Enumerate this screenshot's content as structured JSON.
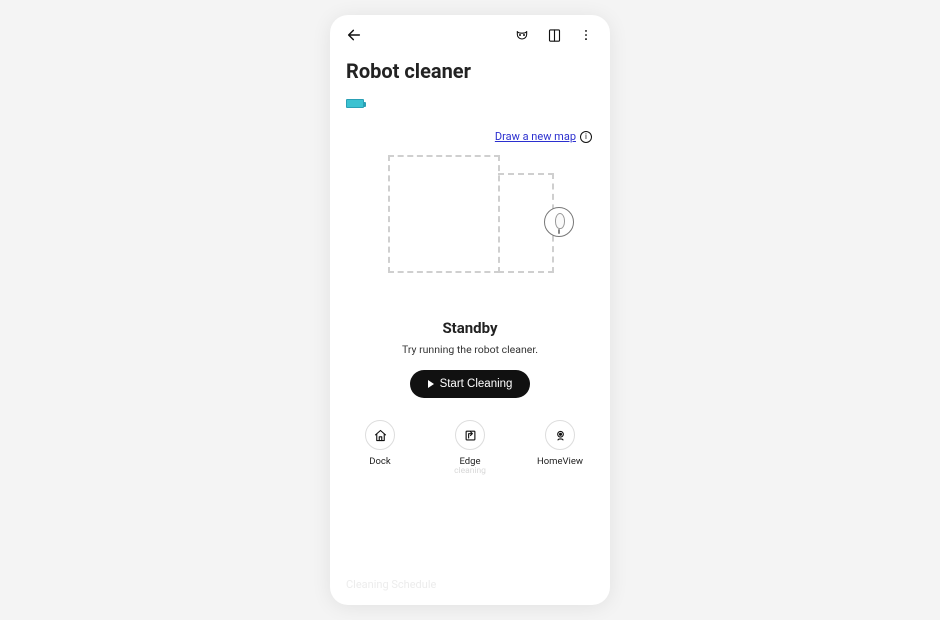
{
  "page": {
    "title": "Robot cleaner"
  },
  "map": {
    "draw_label": "Draw a new map"
  },
  "status": {
    "title": "Standby",
    "subtitle": "Try running the robot cleaner."
  },
  "start": {
    "label": "Start Cleaning"
  },
  "actions": {
    "dock": {
      "label": "Dock"
    },
    "edge": {
      "label": "Edge",
      "sublabel": "cleaning"
    },
    "homeview": {
      "label": "HomeView"
    }
  },
  "footer": {
    "schedule": "Cleaning Schedule"
  }
}
